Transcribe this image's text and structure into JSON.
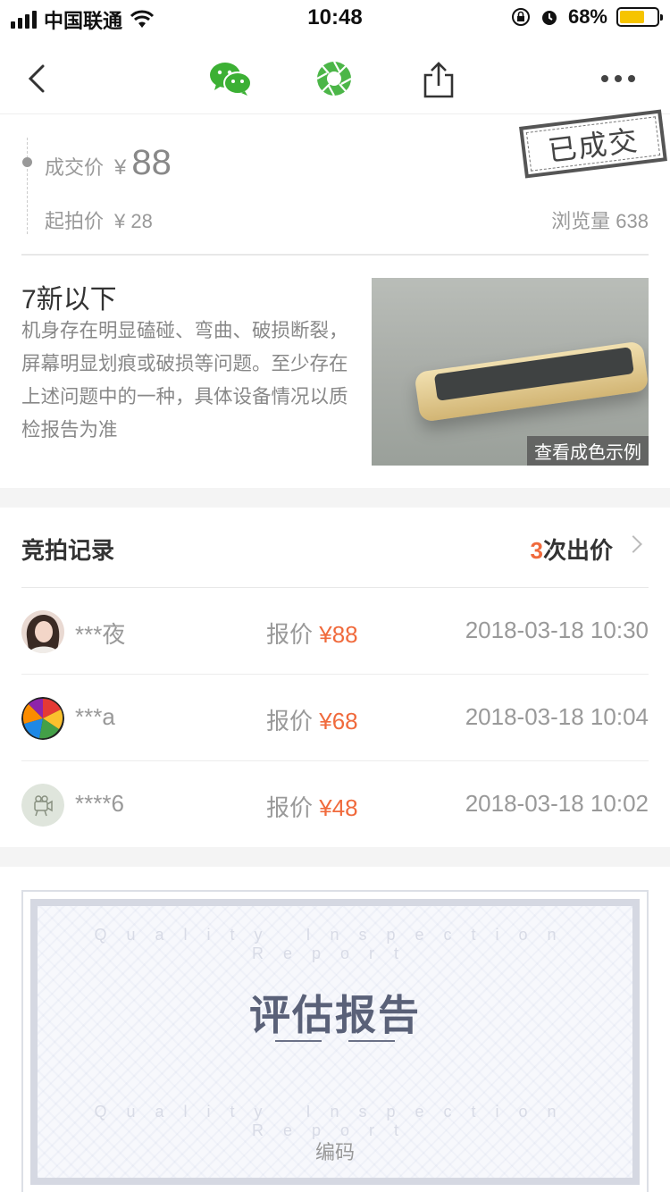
{
  "status_bar": {
    "carrier": "中国联通",
    "time": "10:48",
    "battery": "68%",
    "battery_level": 0.68
  },
  "nav": {
    "icons": [
      "back-icon",
      "wechat-icon",
      "moments-icon",
      "share-icon",
      "more-icon"
    ]
  },
  "price": {
    "deal_label": "成交价",
    "currency": "¥",
    "deal_price": "88",
    "start_label": "起拍价",
    "start_price": "¥ 28",
    "views": "浏览量 638",
    "stamp": "已成交"
  },
  "condition": {
    "title": "7新以下",
    "description": "机身存在明显磕碰、弯曲、破损断裂，屏幕明显划痕或破损等问题。至少存在上述问题中的一种，具体设备情况以质检报告为准",
    "image_caption": "查看成色示例"
  },
  "bids": {
    "title": "竞拍记录",
    "count_num": "3",
    "count_text": "次出价",
    "rows": [
      {
        "name": "***夜",
        "offer_label": "报价",
        "amount": "¥88",
        "time": "2018-03-18 10:30"
      },
      {
        "name": "***a",
        "offer_label": "报价",
        "amount": "¥68",
        "time": "2018-03-18 10:04"
      },
      {
        "name": "****6",
        "offer_label": "报价",
        "amount": "¥48",
        "time": "2018-03-18 10:02"
      }
    ]
  },
  "report": {
    "watermark": "Quality Inspection Report",
    "title": "评估报告",
    "code_label": "编码"
  },
  "colors": {
    "accent": "#f06a3c",
    "wechat_green": "#3cb034",
    "battery": "#f6c400"
  }
}
